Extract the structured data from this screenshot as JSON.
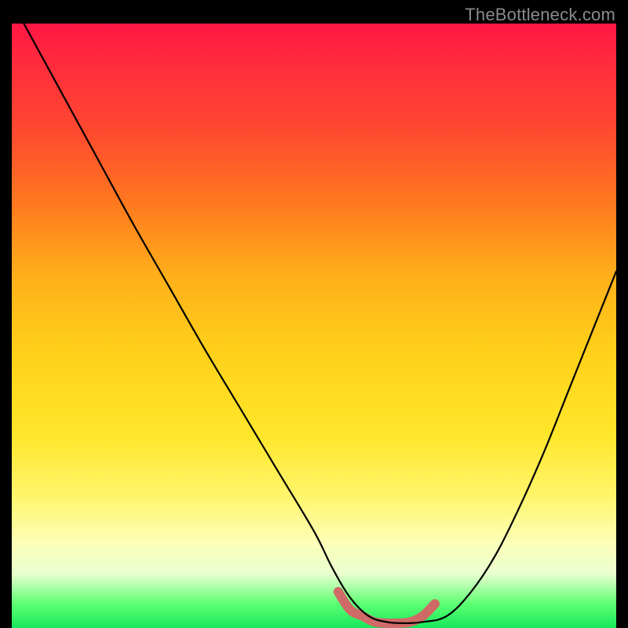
{
  "attribution": "TheBottleneck.com",
  "colors": {
    "background": "#000000",
    "curve": "#000000",
    "accent": "#cf6a67",
    "attribution_text": "#8a8a8a"
  },
  "chart_data": {
    "type": "line",
    "title": "",
    "xlabel": "",
    "ylabel": "",
    "xlim": [
      0,
      100
    ],
    "ylim": [
      0,
      100
    ],
    "grid": false,
    "series": [
      {
        "name": "curve",
        "x": [
          2,
          8,
          14,
          20,
          26,
          32,
          38,
          44,
          50,
          53,
          56,
          59,
          62,
          65,
          68,
          72,
          76,
          80,
          84,
          88,
          92,
          96,
          100
        ],
        "y": [
          100,
          89,
          78,
          67,
          56.5,
          46,
          36,
          26,
          16,
          10,
          5,
          2,
          1,
          0.8,
          1,
          2,
          6,
          12,
          20,
          29,
          39,
          49,
          59
        ]
      }
    ],
    "highlight": {
      "name": "optimal-zone",
      "x_range": [
        54,
        70
      ],
      "description": "flat-bottom minimum segment highlighted",
      "points": [
        {
          "x": 54,
          "y": 6
        },
        {
          "x": 56,
          "y": 3
        },
        {
          "x": 58,
          "y": 2
        },
        {
          "x": 60,
          "y": 1
        },
        {
          "x": 62,
          "y": 0.8
        },
        {
          "x": 64,
          "y": 0.8
        },
        {
          "x": 66,
          "y": 1
        },
        {
          "x": 68,
          "y": 2
        },
        {
          "x": 70,
          "y": 4
        }
      ]
    }
  }
}
